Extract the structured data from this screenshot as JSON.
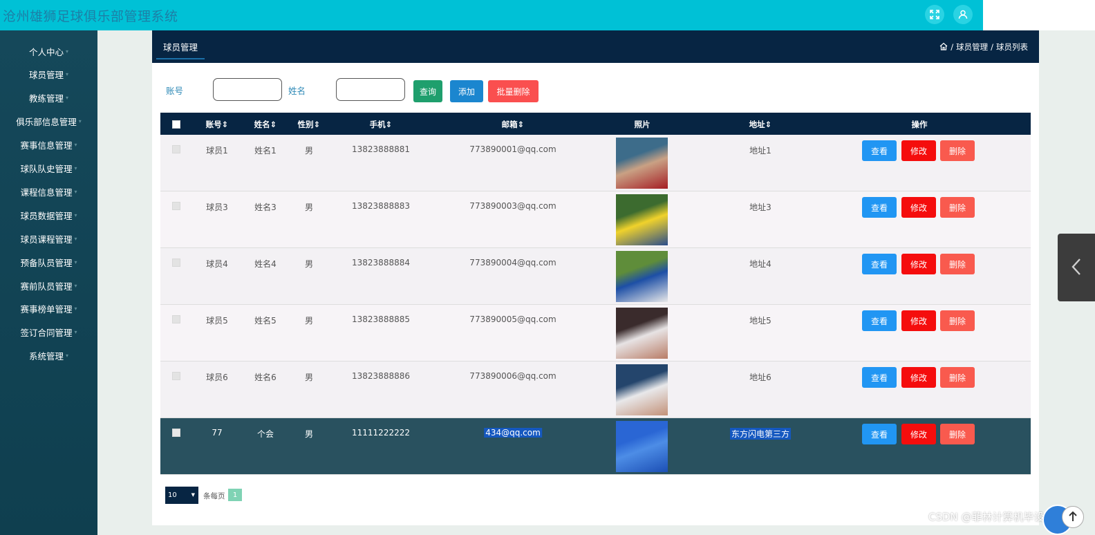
{
  "app": {
    "title": "沧州雄狮足球俱乐部管理系统"
  },
  "header_icons": {
    "fullscreen": "fullscreen-icon",
    "user": "user-icon"
  },
  "sidebar": {
    "items": [
      {
        "label": "个人中心"
      },
      {
        "label": "球员管理"
      },
      {
        "label": "教练管理"
      },
      {
        "label": "俱乐部信息管理"
      },
      {
        "label": "赛事信息管理"
      },
      {
        "label": "球队队史管理"
      },
      {
        "label": "课程信息管理"
      },
      {
        "label": "球员数据管理"
      },
      {
        "label": "球员课程管理"
      },
      {
        "label": "预备队员管理"
      },
      {
        "label": "赛前队员管理"
      },
      {
        "label": "赛事榜单管理"
      },
      {
        "label": "签订合同管理"
      },
      {
        "label": "系统管理"
      }
    ]
  },
  "breadcrumb": {
    "tab": "球员管理",
    "trail": [
      "球员管理",
      "球员列表"
    ],
    "separator": "/"
  },
  "search": {
    "account_label": "账号",
    "name_label": "姓名",
    "account_value": "",
    "name_value": "",
    "query_label": "查询",
    "add_label": "添加",
    "batch_delete_label": "批量删除"
  },
  "table": {
    "headers": {
      "account": "账号",
      "name": "姓名",
      "gender": "性别",
      "phone": "手机",
      "email": "邮箱",
      "photo": "照片",
      "address": "地址",
      "action": "操作"
    },
    "sort_icon": "⇕",
    "rows": [
      {
        "account": "球员1",
        "name": "姓名1",
        "gender": "男",
        "phone": "13823888881",
        "email": "773890001@qq.com",
        "address": "地址1",
        "photo_colors": [
          "#3d6c8a",
          "#c9a184",
          "#a51d24"
        ]
      },
      {
        "account": "球员3",
        "name": "姓名3",
        "gender": "男",
        "phone": "13823888883",
        "email": "773890003@qq.com",
        "address": "地址3",
        "photo_colors": [
          "#3c6b2f",
          "#f0d22b",
          "#2a4d8c"
        ]
      },
      {
        "account": "球员4",
        "name": "姓名4",
        "gender": "男",
        "phone": "13823888884",
        "email": "773890004@qq.com",
        "address": "地址4",
        "photo_colors": [
          "#5f8d3a",
          "#1d4fa6",
          "#e9e9e9"
        ]
      },
      {
        "account": "球员5",
        "name": "姓名5",
        "gender": "男",
        "phone": "13823888885",
        "email": "773890005@qq.com",
        "address": "地址5",
        "photo_colors": [
          "#3a2b2c",
          "#e7e3e4",
          "#b87c66"
        ]
      },
      {
        "account": "球员6",
        "name": "姓名6",
        "gender": "男",
        "phone": "13823888886",
        "email": "773890006@qq.com",
        "address": "地址6",
        "photo_colors": [
          "#24456c",
          "#e8e8ea",
          "#c39178"
        ]
      },
      {
        "account": "77",
        "name": "个会",
        "gender": "男",
        "phone": "11111222222",
        "email": "434@qq.com",
        "address": "东方闪电第三方",
        "photo_colors": [
          "#2a66d4",
          "#4d8de6",
          "#1c4fb5"
        ],
        "selected": true
      }
    ],
    "actions": {
      "view": "查看",
      "edit": "修改",
      "delete": "删除"
    }
  },
  "pagination": {
    "page_size": "10",
    "per_page_label": "条每页",
    "current_page": "1"
  },
  "watermark": "CSDN @菲林计算机毕设",
  "colors": {
    "header": "#00c1d6",
    "sidebar": "#15485a",
    "dark_navy": "#072543",
    "view_btn": "#2196f3",
    "edit_btn": "#f50d0d",
    "delete_btn": "#f95a4e",
    "query_btn": "#1f9f6d",
    "add_btn": "#1b86cf",
    "batch_btn": "#fa4f4f"
  }
}
